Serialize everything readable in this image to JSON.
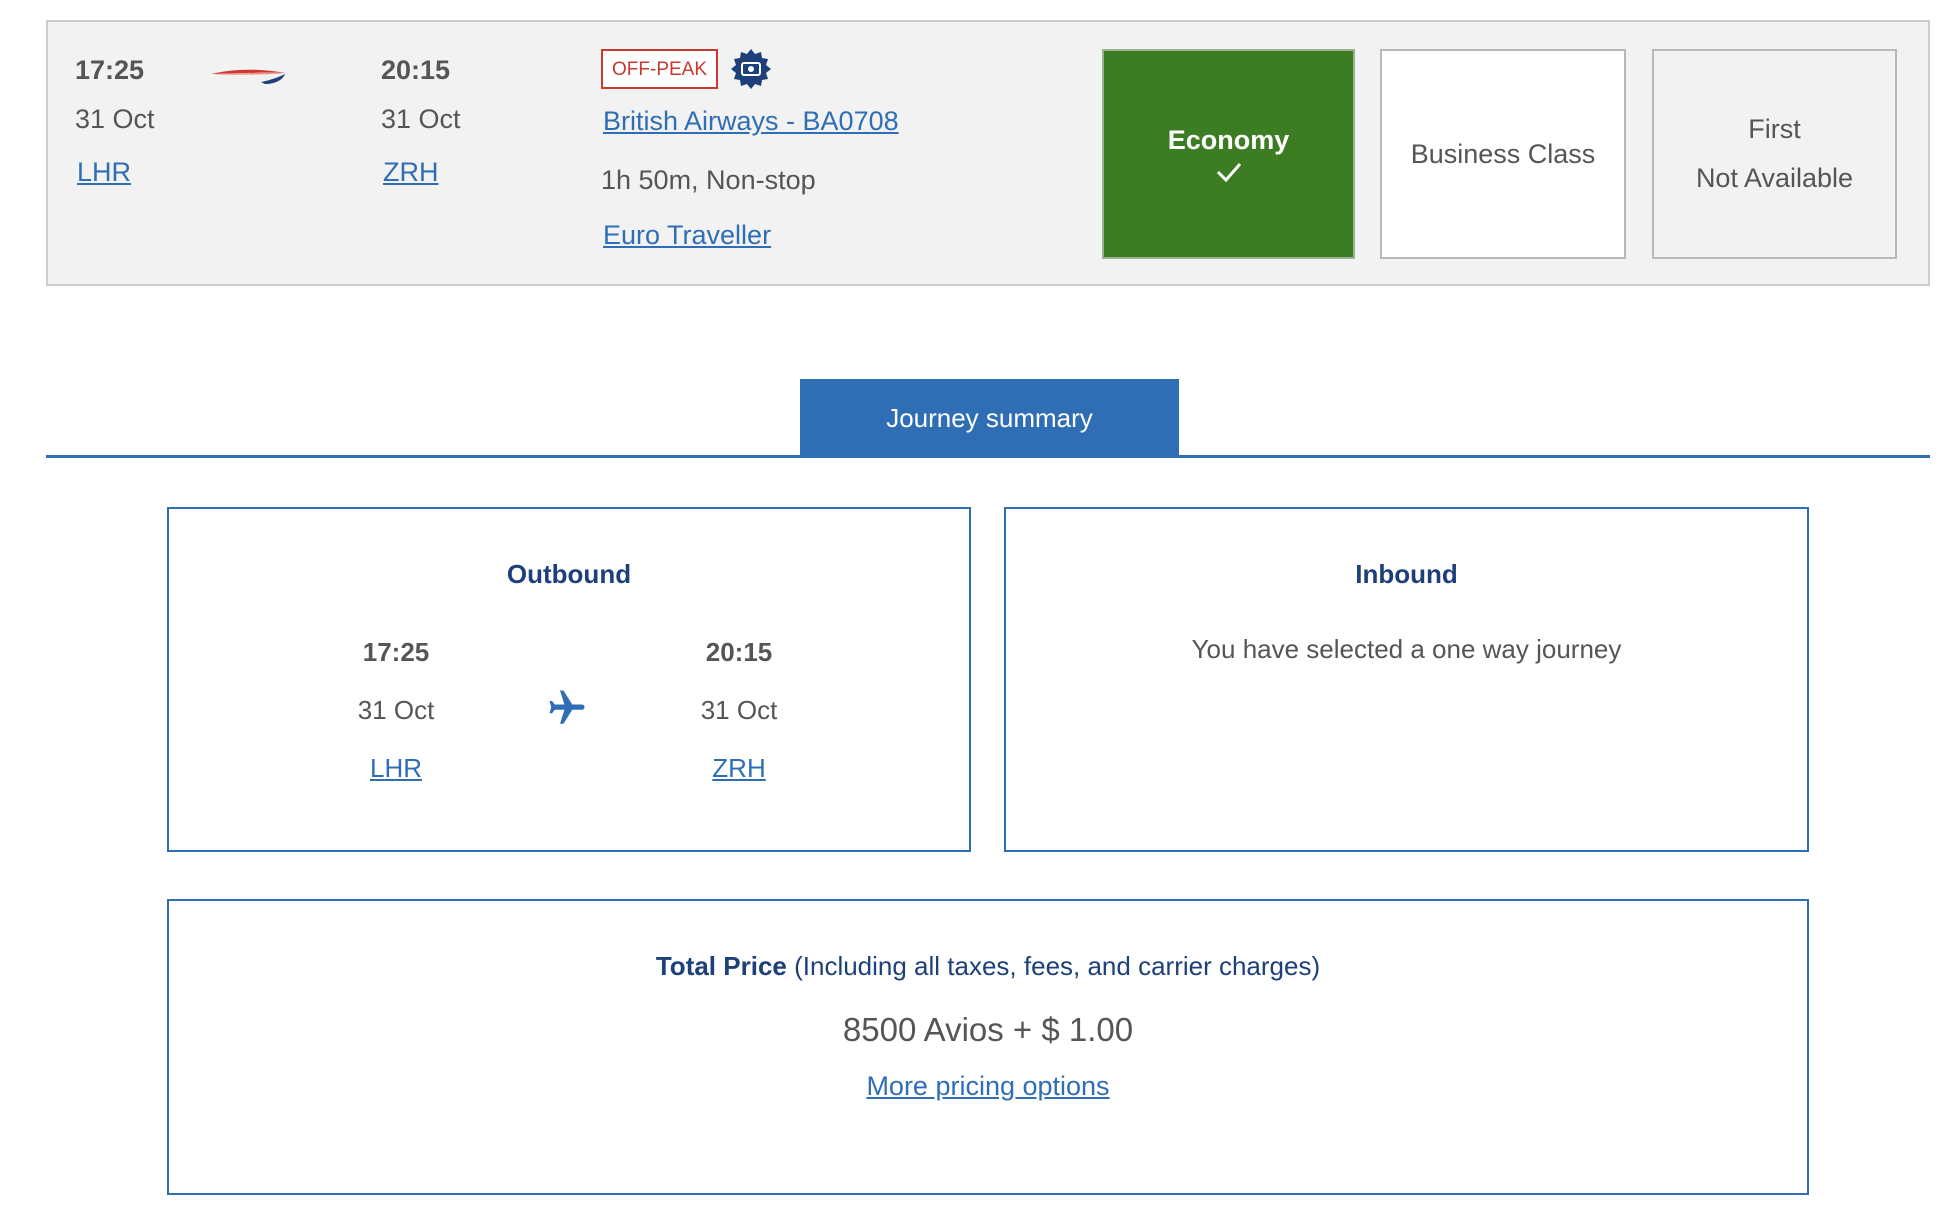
{
  "flight": {
    "depart_time": "17:25",
    "depart_date": "31 Oct",
    "depart_airport": "LHR",
    "arrive_time": "20:15",
    "arrive_date": "31 Oct",
    "arrive_airport": "ZRH",
    "offpeak_label": "OFF-PEAK",
    "airline_flight": "British Airways - BA0708",
    "duration": "1h 50m, Non-stop",
    "cabin_name": "Euro Traveller",
    "icons": {
      "airline_logo": "ba-speedmarque-logo",
      "badge": "offpeak-seal-icon"
    }
  },
  "cabins": {
    "economy": {
      "label": "Economy",
      "selected": true
    },
    "business": {
      "label": "Business Class"
    },
    "first": {
      "label": "First",
      "status": "Not Available"
    }
  },
  "tab": {
    "label": "Journey summary"
  },
  "outbound": {
    "title": "Outbound",
    "depart_time": "17:25",
    "depart_date": "31 Oct",
    "depart_airport": "LHR",
    "arrive_time": "20:15",
    "arrive_date": "31 Oct",
    "arrive_airport": "ZRH"
  },
  "inbound": {
    "title": "Inbound",
    "message": "You have selected a one way journey"
  },
  "price": {
    "title_bold": "Total Price",
    "title_note": " (Including all taxes, fees, and carrier charges)",
    "amount": "8500 Avios + $ 1.00",
    "more_link": "More pricing options"
  },
  "colors": {
    "brand_blue": "#2f6eb5",
    "heading_navy": "#1d3f7a",
    "selected_green": "#3c7d23",
    "offpeak_red": "#c63a2f"
  }
}
